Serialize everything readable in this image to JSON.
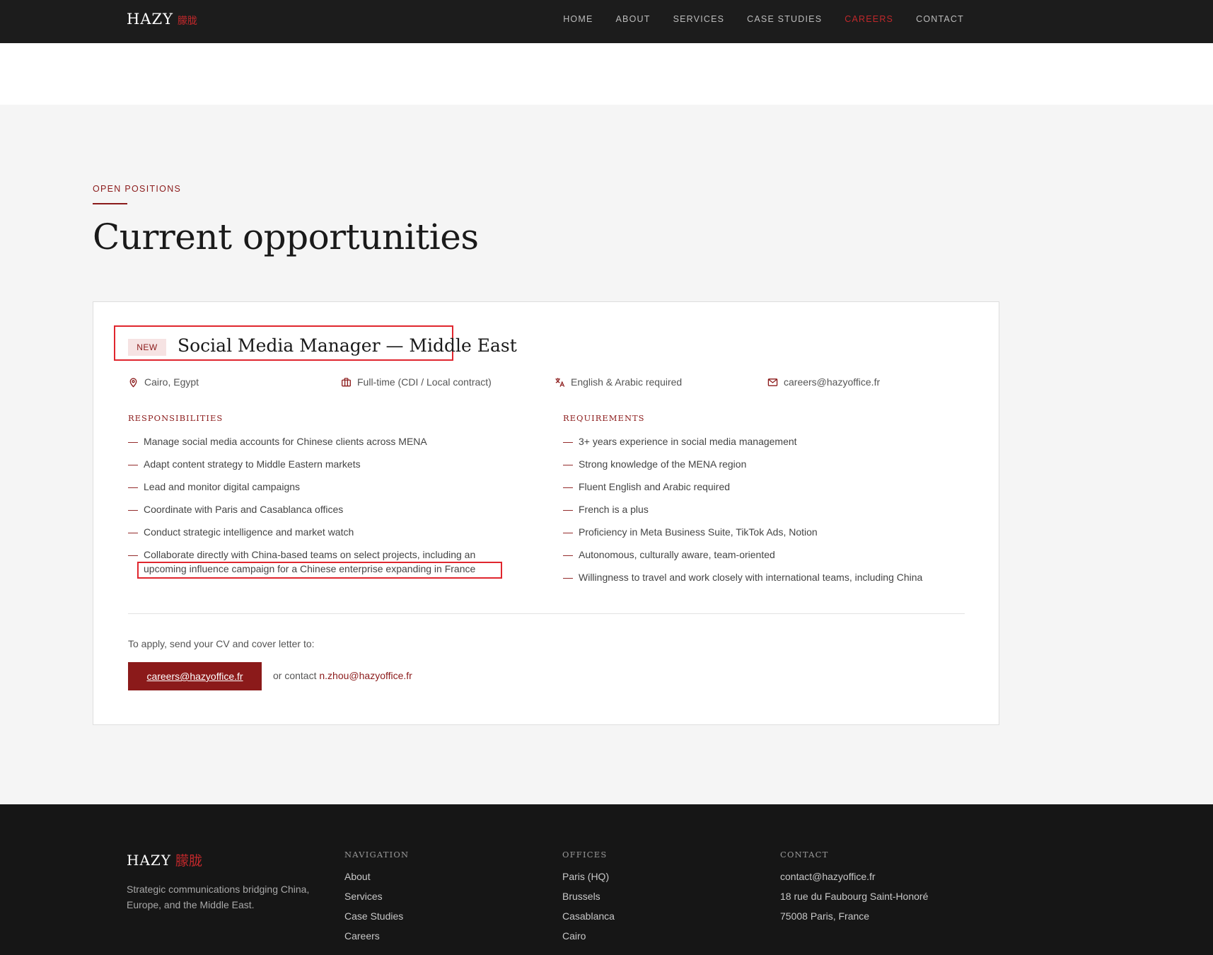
{
  "header": {
    "logo": "HAZY",
    "logo_cn": "朦胧",
    "nav": [
      "HOME",
      "ABOUT",
      "SERVICES",
      "CASE STUDIES",
      "CAREERS",
      "CONTACT"
    ],
    "active": "CAREERS"
  },
  "section": {
    "eyebrow": "OPEN POSITIONS",
    "title": "Current opportunities"
  },
  "job": {
    "badge": "NEW",
    "title": "Social Media Manager — Middle East",
    "location": "Cairo, Egypt",
    "contract": "Full-time (CDI / Local contract)",
    "languages": "English & Arabic required",
    "email": "careers@hazyoffice.fr",
    "responsibilities_heading": "RESPONSIBILITIES",
    "responsibilities": [
      "Manage social media accounts for Chinese clients across MENA",
      "Adapt content strategy to Middle Eastern markets",
      "Lead and monitor digital campaigns",
      "Coordinate with Paris and Casablanca offices",
      "Conduct strategic intelligence and market watch",
      "Collaborate directly with China-based teams on select projects, including an upcoming influence campaign for a Chinese enterprise expanding in France"
    ],
    "requirements_heading": "REQUIREMENTS",
    "requirements": [
      "3+ years experience in social media management",
      "Strong knowledge of the MENA region",
      "Fluent English and Arabic required",
      "French is a plus",
      "Proficiency in Meta Business Suite, TikTok Ads, Notion",
      "Autonomous, culturally aware, team-oriented",
      "Willingness to travel and work closely with international teams, including China"
    ],
    "apply_text": "To apply, send your CV and cover letter to:",
    "apply_button": "careers@hazyoffice.fr",
    "or_contact": "or contact",
    "alt_email": "n.zhou@hazyoffice.fr"
  },
  "footer": {
    "logo": "HAZY",
    "logo_cn": "朦胧",
    "tagline": "Strategic communications bridging China, Europe, and the Middle East.",
    "nav_heading": "NAVIGATION",
    "nav": [
      "About",
      "Services",
      "Case Studies",
      "Careers"
    ],
    "offices_heading": "OFFICES",
    "offices": [
      "Paris (HQ)",
      "Brussels",
      "Casablanca",
      "Cairo"
    ],
    "contact_heading": "CONTACT",
    "contact": [
      "contact@hazyoffice.fr",
      "18 rue du Faubourg Saint-Honoré",
      "75008 Paris, France"
    ]
  },
  "colors": {
    "accent": "#8b1a1a",
    "highlight": "#e0262e",
    "nav_bg": "#1c1c1c",
    "footer_bg": "#161616"
  }
}
